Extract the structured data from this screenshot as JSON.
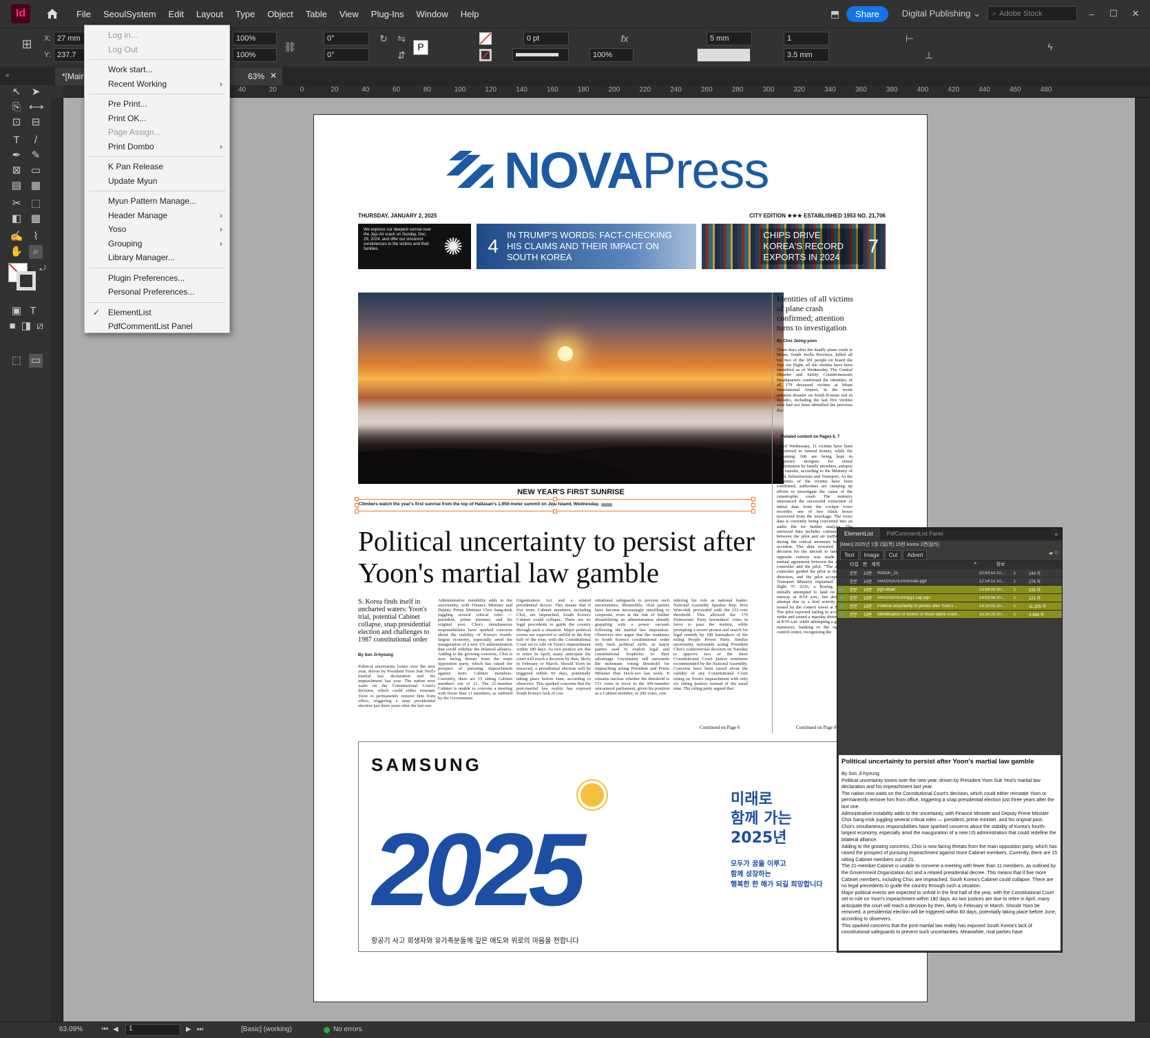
{
  "app": {
    "logo": "Id",
    "menus": [
      "File",
      "SeoulSystem",
      "Edit",
      "Layout",
      "Type",
      "Object",
      "Table",
      "View",
      "Plug-Ins",
      "Window",
      "Help"
    ],
    "share_label": "Share",
    "workspace": "Digital Publishing",
    "stock_placeholder": "Adobe Stock"
  },
  "control_panel": {
    "x_label": "X:",
    "y_label": "Y:",
    "x_value": "27 mm",
    "y_value": "237.7",
    "scale_x": "100%",
    "scale_y": "100%",
    "rotate": "0°",
    "shear": "0°",
    "stroke_weight": "0 pt",
    "opacity": "100%",
    "gutter": "5 mm",
    "columns": "1",
    "column_gap": "3.5 mm"
  },
  "document_tab": {
    "title": "*[Main]",
    "zoom": "63%"
  },
  "ruler": {
    "h_ticks": [
      "40",
      "20",
      "0",
      "20",
      "40",
      "60",
      "80",
      "100",
      "120",
      "140",
      "160",
      "180",
      "200",
      "220",
      "240",
      "260",
      "280",
      "300",
      "320",
      "340",
      "360",
      "380",
      "400",
      "420",
      "440",
      "460",
      "480"
    ]
  },
  "plugin_menu": {
    "items": [
      {
        "label": "Log in...",
        "disabled": true
      },
      {
        "label": "Log Out",
        "disabled": true
      },
      {
        "label": "Work start...",
        "disabled": false
      },
      {
        "label": "Recent Working",
        "disabled": false,
        "submenu": true
      },
      {
        "label": "Pre Print...",
        "disabled": false
      },
      {
        "label": "Print OK...",
        "disabled": false
      },
      {
        "label": "Page Assign...",
        "disabled": true
      },
      {
        "label": "Print Dombo",
        "disabled": false,
        "submenu": true
      },
      {
        "label": "K Pan Release",
        "disabled": false
      },
      {
        "label": "Update Myun",
        "disabled": false
      },
      {
        "label": "Myun Pattern Manage...",
        "disabled": false
      },
      {
        "label": "Header Manage",
        "disabled": false,
        "submenu": true
      },
      {
        "label": "Yoso",
        "disabled": false,
        "submenu": true
      },
      {
        "label": "Grouping",
        "disabled": false,
        "submenu": true
      },
      {
        "label": "Library Manager...",
        "disabled": false
      },
      {
        "label": "Plugin Preferences...",
        "disabled": false
      },
      {
        "label": "Personal Preferences...",
        "disabled": false
      },
      {
        "label": "ElementList",
        "disabled": false,
        "checked": true
      },
      {
        "label": "PdfCommentList Panel",
        "disabled": false
      }
    ]
  },
  "newspaper": {
    "masthead_bold": "NOVA",
    "masthead_light": "Press",
    "date": "THURSDAY, JANUARY 2, 2025",
    "edition": "CITY EDITION ★★★   ESTABLISHED 1953  NO. 21,706",
    "promo_condolence": "We express our deepest sorrow over the Jeju Air crash on Sunday, Dec. 29, 2024, and offer our sincerest condolences to the victims and their families.",
    "promo_trump_num": "4",
    "promo_trump_text": "IN TRUMP'S WORDS: FACT-CHECKING HIS CLAIMS AND THEIR IMPACT ON SOUTH KOREA",
    "promo_chips_text": "CHIPS DRIVE KOREA'S RECORD EXPORTS IN 2024",
    "promo_chips_num": "7",
    "photo_title": "NEW YEAR'S FIRST SUNRISE",
    "photo_caption": "Climbers watch the year's first sunrise from the top of Hallasan's 1,950-meter summit on Jeju Island, Wednesday.",
    "main_headline": "Political uncertainty to persist after Yoon's martial law gamble",
    "deck": "S. Korea finds itself in uncharted waters: Yoon's trial, potential Cabinet collapse, snap presidential election and challenges to 1987 constitutional order",
    "byline_main": "By Son Ji-hyoung",
    "col_lead": "Political uncertainty looms over the new year, driven by President Yoon Suk Yeol's martial law declaration and his impeachment last year. The nation now waits on the Constitutional Court's decision, which could either reinstate Yoon or permanently remove him from office, triggering a snap presidential election just three years after the last one.",
    "col_2": "Administrative instability adds to the uncertainty, with Finance Minister and Deputy Prime Minister Choi Sang-mok juggling several critical roles — president, prime minister, and his original post. Choi's simultaneous responsibilities have sparked concerns about the stability of Korea's fourth-largest economy, especially amid the inauguration of a new US administration that could redefine the bilateral alliance. Adding to the growing concerns, Choi is now facing threats from the main opposition party, which has raised the prospect of pursuing impeachment against more Cabinet members. Currently, there are 15 sitting Cabinet members out of 21. The 21-member Cabinet is unable to convene a meeting with fewer than 11 members, as outlined by the Government",
    "col_3": "Organization Act and a related presidential decree. This means that if five more Cabinet members, including Choi, are impeached, South Korea's Cabinet could collapse. There are no legal precedents to guide the country through such a situation. Major political events are expected to unfold in the first half of the year, with the Constitutional Court set to rule on Yoon's impeachment within 180 days. As two justices are due to retire in April, many anticipate the court will reach a decision by then, likely in February or March. Should Yoon be removed, a presidential election will be triggered within 60 days, potentially taking place before June, according to observers. This sparked concerns that the post-martial law reality has exposed South Korea's lack of con-",
    "col_4": "stitutional safeguards to prevent such uncertainties. Meanwhile, rival parties have become increasingly unwilling to cooperate, even at the risk of further destabilizing an administration already grappling with a power vacuum following the martial law imposition. Observers also argue that the weakness in South Korea's constitutional order only fuels political strife, as major parties seek to exploit legal and constitutional loopholes to their advantage. Uncertainty still surrounds the minimum voting threshold for impeaching acting President and Prime Minister Han Duck-soo last week. It remains unclear whether the threshold is 151 votes in favor in the 300-member unicameral parliament, given his position as a Cabinet member, or 200 votes, con-",
    "col_5": "sidering his role as national leader. National Assembly Speaker Rep. Woo Won-shik proceeded with the 151-vote threshold. This allowed the 170 Democratic Party lawmakers' votes in favor to pass the motion, while prompting a severe protest and search for legal remedy by 108 lawmakers of the ruling People Power Party. Similar uncertainty surrounds acting President Choi's controversial decision on Tuesday to approve two of the three Constitutional Court justice nominees recommended by the National Assembly. Concerns have been raised about the validity of any Constitutional Court ruling on Yoon's impeachment with only six sitting justices instead of the usual nine. The ruling party argued that",
    "continued_main": "Continued on Page 6",
    "side_headline": "Identities of all victims of plane crash confirmed; attention turns to investigation",
    "side_byline": "By Choi Jeong-yoon",
    "side_body": "Three days after the deadly plane crash in Muan, South Jeolla Province, killed all but two of the 181 people on board the Jeju Air flight, all the victims have been identified as of Wednesday. The Central Disaster and Safety Countermeasure Headquarters confirmed the identities of all 179 deceased victims at Muan International Airport, in the worst aviation disaster on South Korean soil in decades, including the last five victims who had not been identified the previous day.",
    "side_related": "Related content on Pages 6, 7",
    "side_body_2": "As of Wednesday, 11 victims have been transferred to funeral homes, while the remaining 168 are being kept in temporary morgues for visual confirmation by family members, autopsy and transfer, according to the Ministry of Land, Infrastructure and Transport. As the identities of the victims have been confirmed, authorities are ramping up efforts to investigate the cause of the catastrophic crash. The ministry announced the successful extraction of initial data from the cockpit voice recorder, one of two black boxes recovered from the wreckage. The voice data is currently being converted into an audio file for further analysis. The retrieved data includes communications between the pilot and air traffic control during the critical moments before the accident. The data revealed that the decision for the aircraft to land on the opposite runway was made through mutual agreement between the air traffic controller and the pilot. \"The air traffic controller guided the pilot to the nearest direction, and the pilot accepted,\" the Transport Ministry explained. Jeju Air flight 7C 2216, a Boeing 737-800, initially attempted to land on the first runway at 8:54 a.m., but aborted the attempt due to a bird activity warning issued by the control tower at 8:57 a.m. The pilot reported failing to avoid a bird strike and issued a mayday distress signal at 8:59 a.m. while attempting a go-around maneuver, banking to the right. The control center, recognizing the",
    "side_continued": "Continued on Page 8",
    "ad_brand": "SAMSUNG",
    "ad_year": "2025",
    "ad_slogan_1": "미래로",
    "ad_slogan_2": "함께 가는",
    "ad_slogan_3": "2025년",
    "ad_sub_1": "모두가 꿈을 이루고",
    "ad_sub_2": "함께 성장하는",
    "ad_sub_3": "행복한 한 해가 되길 희망합니다",
    "ad_notice": "항공기 사고 희생자와 유가족분들께 깊은 애도와 위로의 마음을 전합니다"
  },
  "element_panel": {
    "tabs": [
      "ElementList",
      "PdfCommentList Panel"
    ],
    "path": "[Main]  2025년 1월 2일(목) 15판 korea 1면(컬러)",
    "subtabs": [
      "Text",
      "Image",
      "Cut",
      "Advert"
    ],
    "headers": [
      "타입",
      "판",
      "제목",
      "",
      "정보"
    ],
    "rows": [
      {
        "type": "본문",
        "pan": "15판",
        "title": "INSIDE_15",
        "time": "10:43:53 20...",
        "n": "1",
        "info": "244 자",
        "hl": false
      },
      {
        "type": "본문",
        "pan": "15판",
        "title": "###UPDATE###inside-pg8",
        "time": "12:14:13 20...",
        "n": "1",
        "info": "274 자",
        "hl": false
      },
      {
        "type": "본문",
        "pan": "15판",
        "title": "pg1-ulsan",
        "time": "13:54:33 20...",
        "n": "1",
        "info": "191 자",
        "hl": true
      },
      {
        "type": "본문",
        "pan": "15판",
        "title": "###UPDATE###pg1.cap-jeju",
        "time": "14:03:58 20...",
        "n": "1",
        "info": "121 자",
        "hl": true
      },
      {
        "type": "본문",
        "pan": "15판",
        "title": "Political uncertainty to persist after Yoon's ...",
        "time": "14:10:03 20...",
        "n": "1",
        "info": "11,205 자",
        "hl": true
      },
      {
        "type": "본문",
        "pan": "15판",
        "title": "Identification of victims of Muan plane crash...",
        "time": "15:16:28 20...",
        "n": "1",
        "info": "4,384 자",
        "hl": true
      }
    ],
    "preview_title": "Political uncertainty to persist after Yoon's martial law gamble",
    "preview_body": "By Son Ji-hyoung\nPolitical uncertainty looms over the new year, driven by President Yoon Suk Yeol's martial law declaration and his impeachment last year.\nThe nation now waits on the Constitutional Court's decision, which could either reinstate Yoon or permanently remove him from office, triggering a snap presidential election just three years after the last one.\nAdministrative instability adds to the uncertainty, with Finance Minister and Deputy Prime Minister Choi Sang-mok juggling several critical roles — president, prime minister, and his original post. Choi's simultaneous responsibilities have sparked concerns about the stability of Korea's fourth-largest economy, especially amid the inauguration of a new US administration that could redefine the bilateral alliance.\nAdding to the growing concerns, Choi is now facing threats from the main opposition party, which has raised the prospect of pursuing impeachment against more Cabinet members. Currently, there are 15 sitting Cabinet members out of 21.\nThe 21-member Cabinet is unable to convene a meeting with fewer than 11 members, as outlined by the Government Organization Act and a related presidential decree. This means that if five more Cabinet members, including Choi, are impeached, South Korea's Cabinet could collapse. There are no legal precedents to guide the country through such a situation.\nMajor political events are expected to unfold in the first half of the year, with the Constitutional Court set to rule on Yoon's impeachment within 180 days. As two justices are due to retire in April, many anticipate the court will reach a decision by then, likely in February or March. Should Yoon be removed, a presidential election will be triggered within 60 days, potentially taking place before June, according to observers.\nThis sparked concerns that the post-martial law reality has exposed South Korea's lack of constitutional safeguards to prevent such uncertainties. Meanwhile, rival parties have"
  },
  "statusbar": {
    "zoom": "63.09%",
    "page": "1",
    "master": "[Basic] (working)",
    "preflight": "No errors"
  },
  "colors": {
    "brand_blue": "#1d5aa3",
    "selection_orange": "#f07a30",
    "share_blue": "#1473e6",
    "highlight_row": "#8a8f1c"
  }
}
